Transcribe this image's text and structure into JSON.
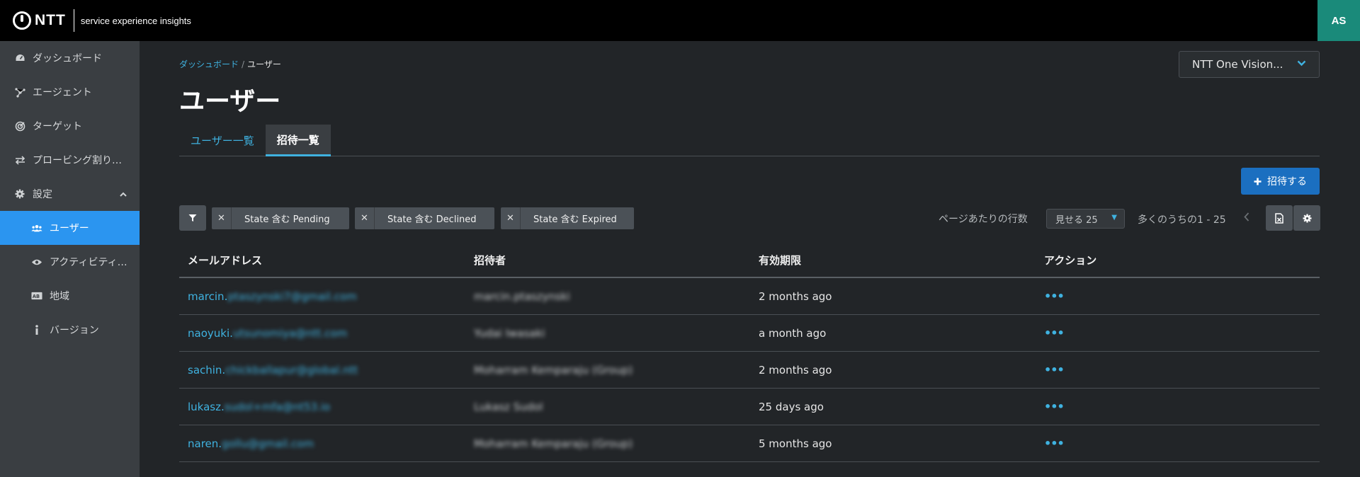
{
  "header": {
    "logo_text": "NTT",
    "product_name": "service experience insights",
    "avatar_initials": "AS"
  },
  "sidebar": {
    "items": [
      {
        "label": "ダッシュボード",
        "icon": "dashboard-icon"
      },
      {
        "label": "エージェント",
        "icon": "agent-icon"
      },
      {
        "label": "ターゲット",
        "icon": "target-icon"
      },
      {
        "label": "プロービング割り…",
        "icon": "transfer-icon"
      },
      {
        "label": "設定",
        "icon": "gear-icon"
      }
    ],
    "sub_items": [
      {
        "label": "ユーザー",
        "icon": "users-icon"
      },
      {
        "label": "アクティビティ…",
        "icon": "eye-icon"
      },
      {
        "label": "地域",
        "icon": "region-icon"
      },
      {
        "label": "バージョン",
        "icon": "info-icon"
      }
    ]
  },
  "breadcrumb": {
    "parent": "ダッシュボード",
    "separator": "/",
    "current": "ユーザー"
  },
  "page_title": "ユーザー",
  "org_selector": {
    "value": "NTT One Vision..."
  },
  "tabs": [
    {
      "label": "ユーザー一覧"
    },
    {
      "label": "招待一覧"
    }
  ],
  "invite_button": {
    "label": "招待する"
  },
  "filters": [
    {
      "label": "State 含む Pending"
    },
    {
      "label": "State 含む Declined"
    },
    {
      "label": "State 含む Expired"
    }
  ],
  "pagination": {
    "rows_label": "ページあたりの行数",
    "rows_value": "見せる 25",
    "range_text": "多くのうちの1 - 25"
  },
  "table": {
    "headers": [
      "メールアドレス",
      "招待者",
      "有効期限",
      "アクション"
    ],
    "rows": [
      {
        "email_user": "marcin.",
        "email_rest": "ptaszynski7@gmail.com",
        "inviter": "marcin.ptaszynski",
        "expiry": "2 months ago",
        "action": "•••"
      },
      {
        "email_user": "naoyuki.",
        "email_rest": "utsunomiya@ntt.com",
        "inviter": "Yudai Iwasaki",
        "expiry": "a month ago",
        "action": "•••"
      },
      {
        "email_user": "sachin.",
        "email_rest": "chickballapur@global.ntt",
        "inviter": "Moharram Kemparaju (Group)",
        "expiry": "2 months ago",
        "action": "•••"
      },
      {
        "email_user": "lukasz.",
        "email_rest": "sudol+mfa@nt53.io",
        "inviter": "Lukasz Sudol",
        "expiry": "25 days ago",
        "action": "•••"
      },
      {
        "email_user": "naren.",
        "email_rest": "gollu@gmail.com",
        "inviter": "Moharram Kemparaju (Group)",
        "expiry": "5 months ago",
        "action": "•••"
      }
    ]
  },
  "colors": {
    "accent": "#3fb2e0",
    "active_nav": "#2b95f0",
    "primary_button": "#1b6fc0",
    "avatar_bg": "#1a8a7a"
  }
}
